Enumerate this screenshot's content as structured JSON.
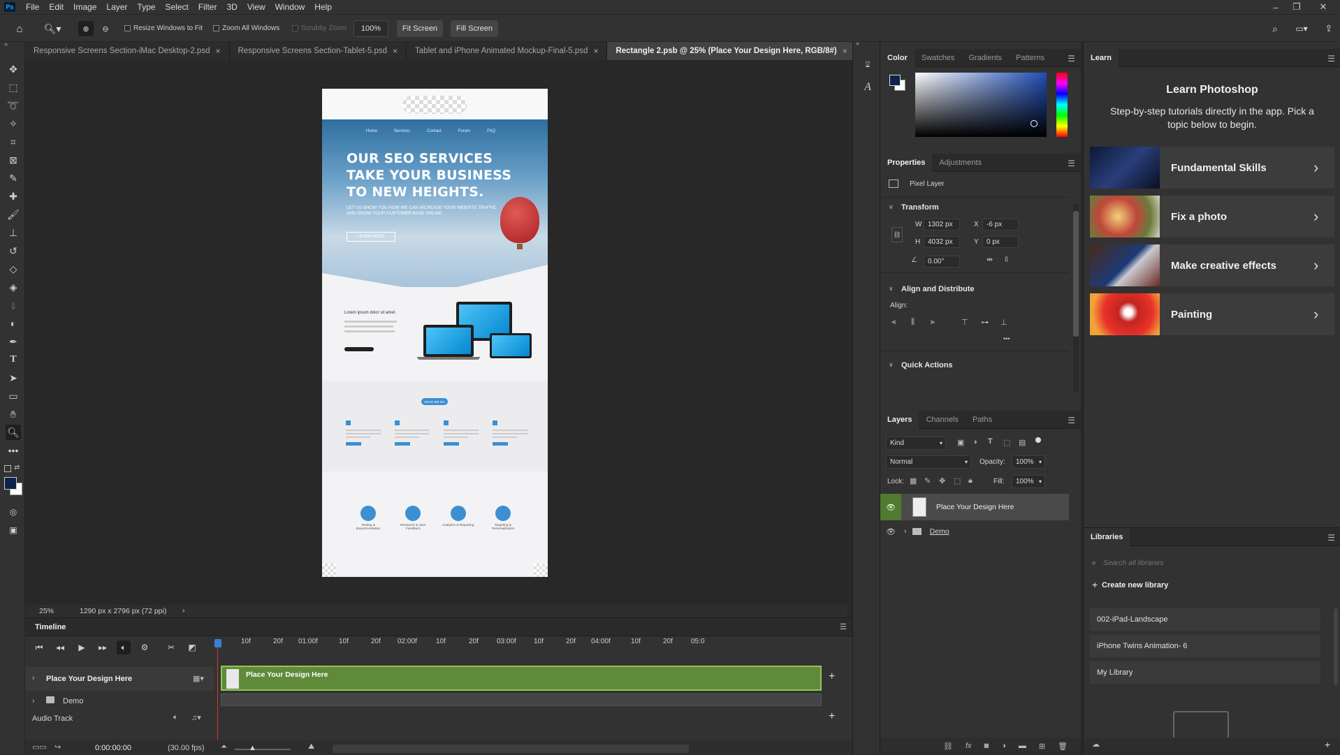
{
  "app": {
    "logo": "Ps"
  },
  "menu": [
    "File",
    "Edit",
    "Image",
    "Layer",
    "Type",
    "Select",
    "Filter",
    "3D",
    "View",
    "Window",
    "Help"
  ],
  "options": {
    "resize_windows": "Resize Windows to Fit",
    "zoom_all": "Zoom All Windows",
    "scrubby": "Scrubby Zoom",
    "zoom_value": "100%",
    "fit_screen": "Fit Screen",
    "fill_screen": "Fill Screen"
  },
  "tabs": [
    {
      "label": "Responsive Screens Section-iMac Desktop-2.psd",
      "active": false
    },
    {
      "label": "Responsive Screens Section-Tablet-5.psd",
      "active": false
    },
    {
      "label": "Tablet and iPhone Animated Mockup-Final-5.psd",
      "active": false
    },
    {
      "label": "Rectangle 2.psb @ 25% (Place Your Design Here, RGB/8#)",
      "active": true
    }
  ],
  "tab_close": "×",
  "mockup": {
    "nav": [
      "Home",
      "Services",
      "Contact",
      "Forum",
      "FAQ"
    ],
    "hero_title_lines": [
      "OUR SEO SERVICES",
      "TAKE YOUR BUSINESS",
      "TO NEW HEIGHTS."
    ],
    "hero_sub": "LET US SHOW YOU HOW WE CAN INCREASE YOUR WEBSITE TRAFFIC AND GROW YOUR CUSTOMER BASE ONLINE.",
    "hero_btn": "LEARN MORE",
    "lorem": "Lorem ipsum dolor sit amet.",
    "pill": "WHAT WE DO",
    "features": [
      {
        "name": "Testing & Experimentation"
      },
      {
        "name": "Research & User Feedback"
      },
      {
        "name": "Analytics & Reporting"
      },
      {
        "name": "Targeting & Personalization"
      }
    ]
  },
  "status": {
    "zoom": "25%",
    "doc_size": "1290 px x 2796 px (72 ppi)",
    "arrow": "›"
  },
  "timeline": {
    "title": "Timeline",
    "ruler": [
      "10f",
      "20f",
      "01:00f",
      "10f",
      "20f",
      "02:00f",
      "10f",
      "20f",
      "03:00f",
      "10f",
      "20f",
      "04:00f",
      "10f",
      "20f",
      "05:0"
    ],
    "tracks": [
      {
        "name": "Place Your Design Here"
      },
      {
        "name": "Demo"
      },
      {
        "name": "Audio Track"
      }
    ],
    "clip": "Place Your Design Here",
    "time": "0:00:00:00",
    "fps": "(30.00 fps)"
  },
  "color_panel": {
    "tabs": [
      "Color",
      "Swatches",
      "Gradients",
      "Patterns"
    ],
    "fg": "#0d2349",
    "bg": "#ffffff"
  },
  "properties": {
    "tabs": [
      "Properties",
      "Adjustments"
    ],
    "layer_type": "Pixel Layer",
    "transform": "Transform",
    "w_label": "W",
    "w": "1302 px",
    "x_label": "X",
    "x": "-6 px",
    "h_label": "H",
    "h": "4032 px",
    "y_label": "Y",
    "y": "0 px",
    "angle": "0.00°",
    "align_title": "Align and Distribute",
    "align_label": "Align:",
    "more": "•••",
    "quick_actions": "Quick Actions"
  },
  "layers": {
    "tabs": [
      "Layers",
      "Channels",
      "Paths"
    ],
    "kind": "Kind",
    "blend": "Normal",
    "opacity_label": "Opacity:",
    "opacity": "100%",
    "lock_label": "Lock:",
    "fill_label": "Fill:",
    "fill": "100%",
    "items": [
      {
        "name": "Place Your Design Here",
        "selected": true
      },
      {
        "name": "Demo",
        "selected": false
      }
    ]
  },
  "learn": {
    "tab": "Learn",
    "title": "Learn Photoshop",
    "subtitle": "Step-by-step tutorials directly in the app. Pick a topic below to begin.",
    "cards": [
      {
        "label": "Fundamental Skills"
      },
      {
        "label": "Fix a photo"
      },
      {
        "label": "Make creative effects"
      },
      {
        "label": "Painting"
      }
    ],
    "chevron": "›"
  },
  "libraries": {
    "tab": "Libraries",
    "search_placeholder": "Search all libraries",
    "create": "Create new library",
    "items": [
      "002-iPad-Landscape",
      "iPhone Twins Animation- 6",
      "My Library"
    ]
  }
}
